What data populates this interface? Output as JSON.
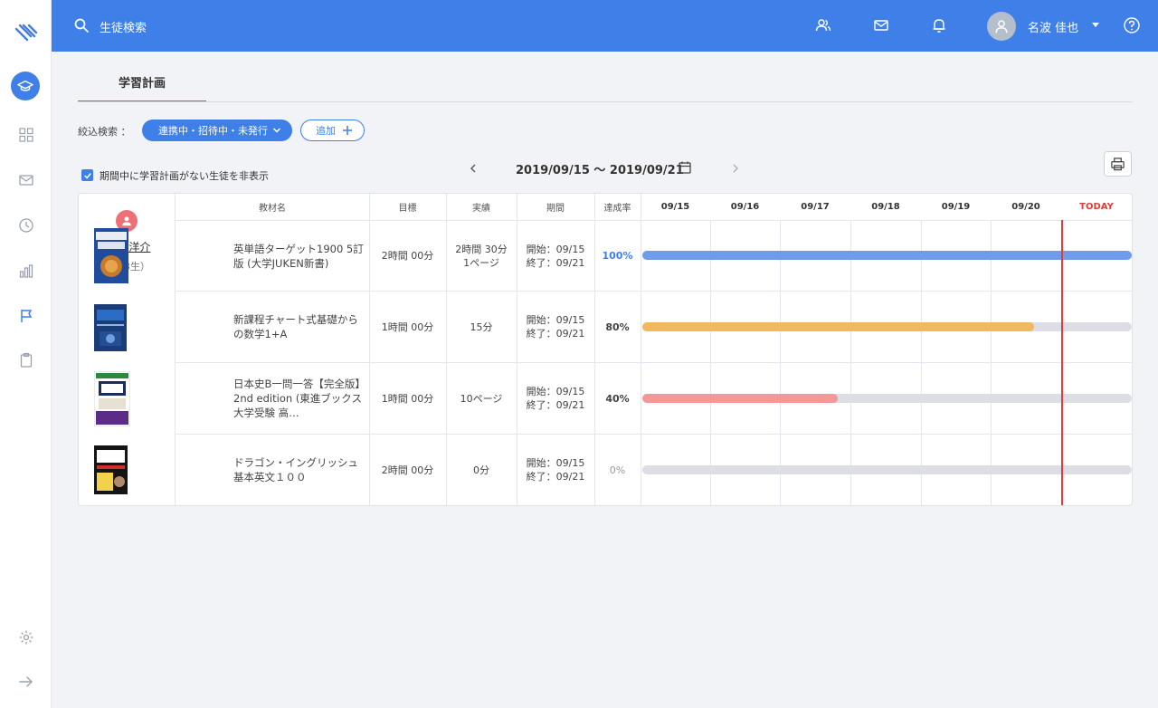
{
  "header": {
    "search_placeholder": "生徒検索",
    "user_name": "名波 佳也"
  },
  "sidebar": {
    "icons": [
      "logo-icon",
      "graduation-cap-icon",
      "grid-icon",
      "mail-icon",
      "clock-icon",
      "bar-chart-icon",
      "flag-icon",
      "clipboard-icon",
      "gear-icon",
      "arrow-right-icon"
    ]
  },
  "tabs": {
    "active": "学習計画"
  },
  "filter": {
    "label": "絞込検索 ：",
    "chip": "連携中・招待中・未発行",
    "add": "追加"
  },
  "hide_checkbox": {
    "label": "期間中に学習計画がない生徒を非表示",
    "checked": true
  },
  "date_range": "2019/09/15 〜 2019/09/21",
  "columns": {
    "material": "教材名",
    "goal": "目標",
    "actual": "実績",
    "period": "期間",
    "rate": "達成率",
    "days": [
      "09/15",
      "09/16",
      "09/17",
      "09/18",
      "09/19",
      "09/20",
      "TODAY"
    ]
  },
  "student": {
    "name": "森下 洋介",
    "grade": "（高3生）"
  },
  "rows": [
    {
      "title": "英単語ターゲット1900 5訂版 (大学JUKEN新書)",
      "goal": "2時間 00分",
      "actual_1": "2時間 30分",
      "actual_2": "1ページ",
      "start": "開始：09/15",
      "end": "終了：09/21",
      "rate": "100%",
      "progress": 1.0,
      "color": "#6f9ce8"
    },
    {
      "title": "新課程チャート式基礎からの数学1+A",
      "goal": "1時間 00分",
      "actual_1": "15分",
      "actual_2": "",
      "start": "開始：09/15",
      "end": "終了：09/21",
      "rate": "80%",
      "progress": 0.8,
      "color": "#f2b861"
    },
    {
      "title": "日本史B一問一答【完全版】2nd edition (東進ブックス 大学受験 高…",
      "goal": "1時間 00分",
      "actual_1": "10ページ",
      "actual_2": "",
      "start": "開始：09/15",
      "end": "終了：09/21",
      "rate": "40%",
      "progress": 0.4,
      "color": "#f59797"
    },
    {
      "title": "ドラゴン・イングリッシュ基本英文１００",
      "goal": "2時間 00分",
      "actual_1": "0分",
      "actual_2": "",
      "start": "開始：09/15",
      "end": "終了：09/21",
      "rate": "0%",
      "progress": 0.0,
      "color": "#dcdde5"
    }
  ],
  "colors": {
    "accent": "#3f7fe8",
    "today": "#e03a3a",
    "rate_blue": "#3f7fe8",
    "rate_zero": "#999999"
  }
}
